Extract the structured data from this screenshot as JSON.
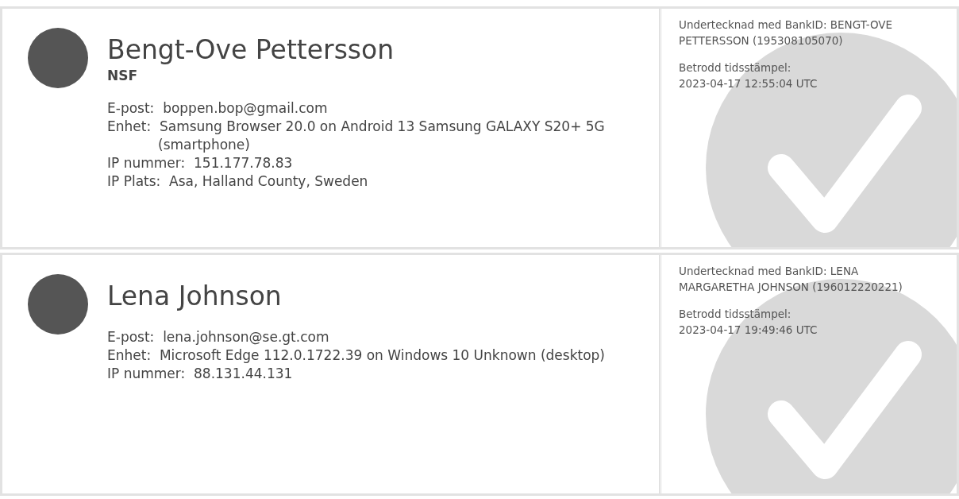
{
  "signers": [
    {
      "name": "Bengt-Ove Pettersson",
      "organization": "NSF",
      "details": [
        {
          "label": "E-post:",
          "value": "boppen.bop@gmail.com"
        },
        {
          "label": "Enhet:",
          "value": "Samsung Browser 20.0 on Android 13 Samsung GALAXY S20+ 5G (smartphone)"
        },
        {
          "label": "IP nummer:",
          "value": "151.177.78.83"
        },
        {
          "label": "IP Plats:",
          "value": "Asa, Halland County, Sweden"
        }
      ],
      "signed_text": "Undertecknad med BankID: BENGT-OVE PETTERSSON (195308105070)",
      "timestamp_label": "Betrodd tidsstämpel:",
      "timestamp": "2023-04-17 12:55:04 UTC"
    },
    {
      "name": "Lena Johnson",
      "details": [
        {
          "label": "E-post:",
          "value": "lena.johnson@se.gt.com"
        },
        {
          "label": "Enhet:",
          "value": "Microsoft Edge 112.0.1722.39 on Windows 10 Unknown (desktop)"
        },
        {
          "label": "IP nummer:",
          "value": "88.131.44.131"
        }
      ],
      "signed_text": "Undertecknad med BankID: LENA MARGARETHA JOHNSON (196012220221)",
      "timestamp_label": "Betrodd tidsstämpel:",
      "timestamp": "2023-04-17 19:49:46 UTC"
    }
  ]
}
